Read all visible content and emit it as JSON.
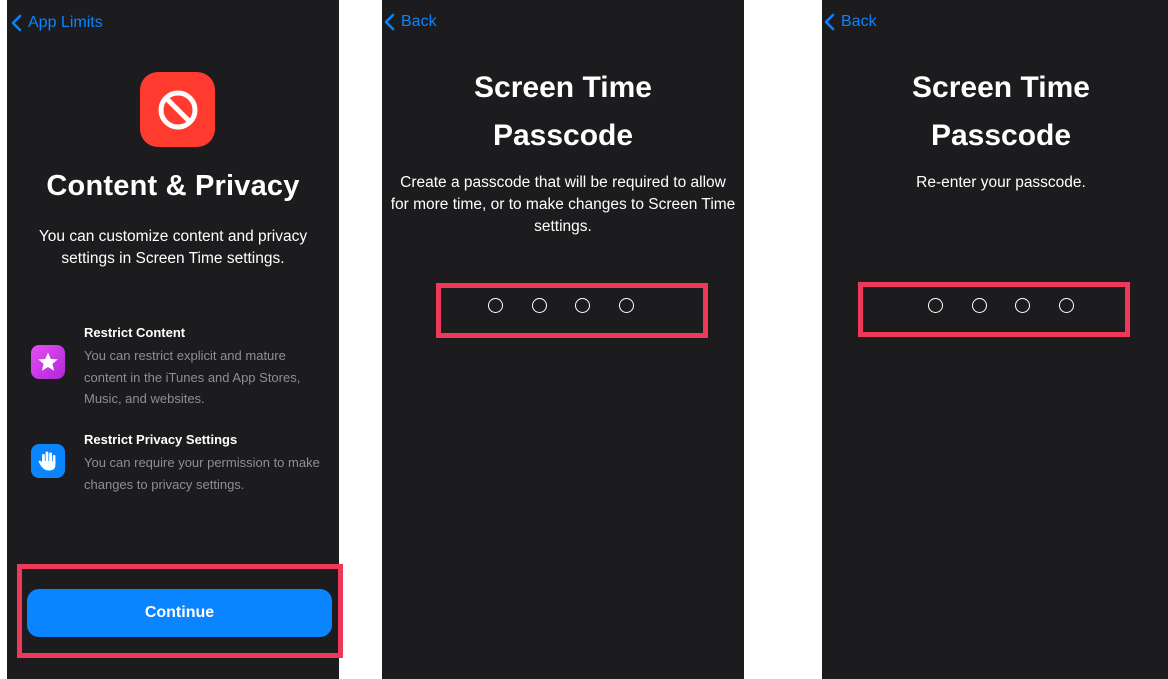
{
  "screen1": {
    "back_label": "App Limits",
    "title": "Content & Privacy",
    "subtitle": "You can customize content and privacy settings in Screen Time settings.",
    "features": [
      {
        "title": "Restrict Content",
        "description": "You can restrict explicit and mature content in the iTunes and App Stores, Music, and websites.",
        "icon": "star-icon"
      },
      {
        "title": "Restrict Privacy Settings",
        "description": "You can require your permission to make changes to privacy settings.",
        "icon": "hand-icon"
      }
    ],
    "continue_label": "Continue",
    "app_icon": "no-entry-icon"
  },
  "screen2": {
    "back_label": "Back",
    "title_line1": "Screen Time",
    "title_line2": "Passcode",
    "description": "Create a passcode that will be required to allow for more time, or to make changes to Screen Time settings."
  },
  "screen3": {
    "back_label": "Back",
    "title_line1": "Screen Time",
    "title_line2": "Passcode",
    "description": "Re-enter your passcode."
  },
  "colors": {
    "background": "#1c1c1e",
    "accent": "#0a84ff",
    "app_icon": "#ff3b30",
    "highlight": "#f0385a",
    "secondary_text": "#8e8e93"
  }
}
